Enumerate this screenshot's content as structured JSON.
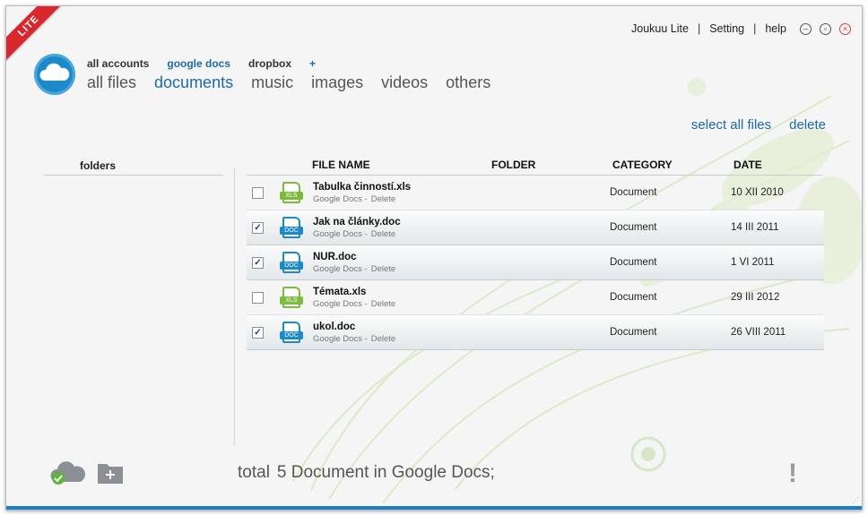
{
  "app": {
    "badge": "LITE"
  },
  "titlebar": {
    "app_name": "Joukuu Lite",
    "setting": "Setting",
    "help": "help",
    "separator": "|"
  },
  "accounts": [
    {
      "label": "all accounts",
      "active": false
    },
    {
      "label": "google docs",
      "active": true
    },
    {
      "label": "dropbox",
      "active": false
    },
    {
      "label": "+",
      "active": false
    }
  ],
  "categories": [
    {
      "label": "all files",
      "active": false
    },
    {
      "label": "documents",
      "active": true
    },
    {
      "label": "music",
      "active": false
    },
    {
      "label": "images",
      "active": false
    },
    {
      "label": "videos",
      "active": false
    },
    {
      "label": "others",
      "active": false
    }
  ],
  "actions": {
    "select_all": "select all files",
    "delete": "delete"
  },
  "sidebar": {
    "title": "folders"
  },
  "table": {
    "headers": {
      "name": "FILE NAME",
      "folder": "FOLDER",
      "category": "CATEGORY",
      "date": "DATE"
    },
    "rows": [
      {
        "name": "Tabulka činností.xls",
        "type": "xls",
        "type_label": "XLS",
        "source": "Google Docs -",
        "action": "Delete",
        "category": "Document",
        "date": "10 XII 2010",
        "checked": false
      },
      {
        "name": "Jak na články.doc",
        "type": "doc",
        "type_label": "DOC",
        "source": "Google Docs -",
        "action": "Delete",
        "category": "Document",
        "date": "14 III 2011",
        "checked": true
      },
      {
        "name": "NUR.doc",
        "type": "doc",
        "type_label": "DOC",
        "source": "Google Docs -",
        "action": "Delete",
        "category": "Document",
        "date": "1 VI 2011",
        "checked": true
      },
      {
        "name": "Témata.xls",
        "type": "xls",
        "type_label": "XLS",
        "source": "Google Docs -",
        "action": "Delete",
        "category": "Document",
        "date": "29 III 2012",
        "checked": false
      },
      {
        "name": "ukol.doc",
        "type": "doc",
        "type_label": "DOC",
        "source": "Google Docs -",
        "action": "Delete",
        "category": "Document",
        "date": "26 VIII 2011",
        "checked": true
      }
    ]
  },
  "footer": {
    "total_label": "total",
    "total_value": "5 Document in Google Docs;",
    "alert": "!"
  },
  "colors": {
    "accent": "#1e6aa8",
    "ribbon": "#d8282d",
    "doc_icon": "#1c8ac8",
    "xls_icon": "#7dbb3c"
  },
  "icons": {
    "logo": "cloud-icon",
    "sync": "cloud-sync-icon",
    "new_folder": "add-folder-icon"
  }
}
